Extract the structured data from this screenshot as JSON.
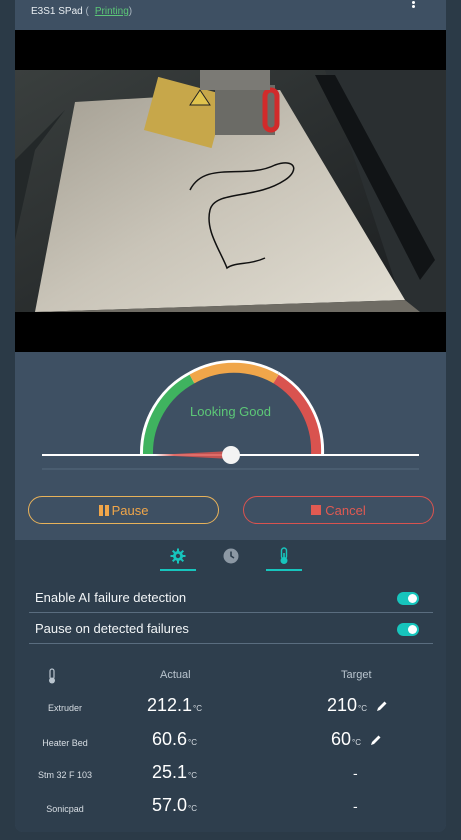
{
  "header": {
    "printer_name": "E3S1 SPad",
    "status_open": "(",
    "status": "Printing",
    "status_close": ")"
  },
  "gauge": {
    "label": "Looking Good",
    "level": 0.12
  },
  "controls": {
    "pause_label": "Pause",
    "cancel_label": "Cancel"
  },
  "tabs": [
    {
      "icon": "gear-icon",
      "active": true
    },
    {
      "icon": "clock-icon",
      "active": false
    },
    {
      "icon": "thermometer-icon",
      "active": true
    }
  ],
  "settings": [
    {
      "label": "Enable AI failure detection",
      "enabled": true
    },
    {
      "label": "Pause on detected failures",
      "enabled": true
    }
  ],
  "temperatures": {
    "header_actual": "Actual",
    "header_target": "Target",
    "rows": [
      {
        "name": "Extruder",
        "actual": "212.1",
        "actual_unit": "°C",
        "target": "210",
        "target_unit": "°C",
        "editable": true
      },
      {
        "name": "Heater Bed",
        "actual": "60.6",
        "actual_unit": "°C",
        "target": "60",
        "target_unit": "°C",
        "editable": true
      },
      {
        "name": "Stm 32 F 103",
        "actual": "25.1",
        "actual_unit": "°C",
        "target": "-",
        "editable": false
      },
      {
        "name": "Sonicpad",
        "actual": "57.0",
        "actual_unit": "°C",
        "target": "-",
        "editable": false
      }
    ]
  },
  "colors": {
    "accent": "#17c5bd",
    "good": "#5cc777",
    "warn": "#f0a64a",
    "danger": "#e05a52"
  }
}
